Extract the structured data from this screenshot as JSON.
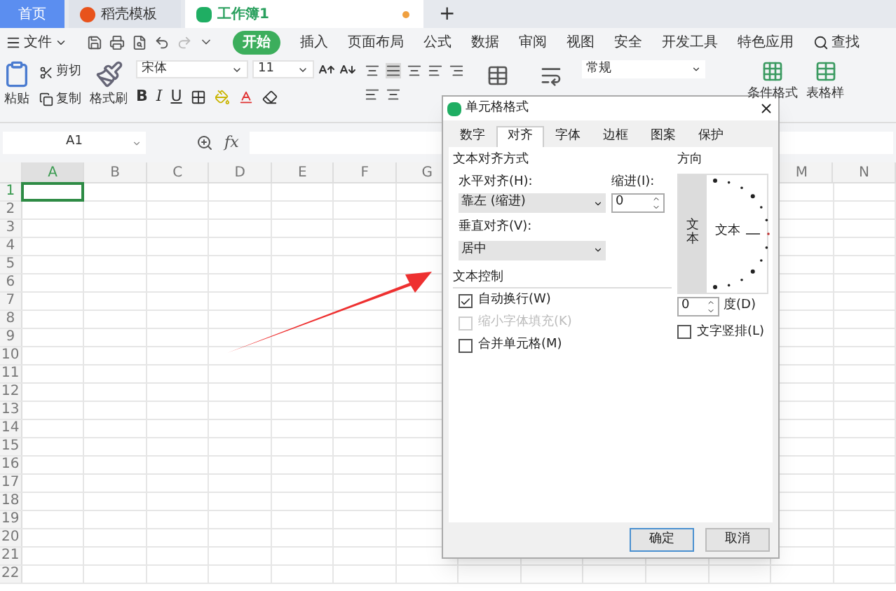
{
  "tabs": [
    {
      "label": "首页",
      "selected": false,
      "kind": "home"
    },
    {
      "label": "稻壳模板",
      "selected": false,
      "kind": "docer"
    },
    {
      "label": "工作簿1",
      "selected": true,
      "kind": "sheet"
    }
  ],
  "new_tab": "+",
  "menu": {
    "file": "文件",
    "tabs": [
      {
        "label": "开始",
        "selected": true
      },
      {
        "label": "插入",
        "selected": false
      },
      {
        "label": "页面布局",
        "selected": false
      },
      {
        "label": "公式",
        "selected": false
      },
      {
        "label": "数据",
        "selected": false
      },
      {
        "label": "审阅",
        "selected": false
      },
      {
        "label": "视图",
        "selected": false
      },
      {
        "label": "安全",
        "selected": false
      },
      {
        "label": "开发工具",
        "selected": false
      },
      {
        "label": "特色应用",
        "selected": false
      }
    ],
    "search": "查找"
  },
  "ribbon": {
    "paste": "粘贴",
    "cut": "剪切",
    "copy": "复制",
    "format_painter": "格式刷",
    "font": "宋体",
    "size": "11",
    "styles": [
      "B",
      "I",
      "U"
    ],
    "number_format": "常规",
    "conditional_format": "条件格式",
    "table_style": "表格样"
  },
  "formula_bar": {
    "cell": "A1",
    "fx": "fx"
  },
  "sheet": {
    "columns_left": [
      {
        "label": "A",
        "selected": true
      },
      {
        "label": "B",
        "selected": false
      },
      {
        "label": "C",
        "selected": false
      },
      {
        "label": "D",
        "selected": false
      },
      {
        "label": "E",
        "selected": false
      },
      {
        "label": "F",
        "selected": false
      },
      {
        "label": "G",
        "selected": false
      }
    ],
    "columns_right": [
      {
        "label": "M",
        "selected": false
      },
      {
        "label": "N",
        "selected": false
      }
    ],
    "rows": [
      {
        "label": "1",
        "selected": true
      },
      {
        "label": "2",
        "selected": false
      },
      {
        "label": "3",
        "selected": false
      },
      {
        "label": "4",
        "selected": false
      },
      {
        "label": "5",
        "selected": false
      },
      {
        "label": "6",
        "selected": false
      },
      {
        "label": "7",
        "selected": false
      },
      {
        "label": "8",
        "selected": false
      },
      {
        "label": "9",
        "selected": false
      },
      {
        "label": "10",
        "selected": false
      },
      {
        "label": "11",
        "selected": false
      },
      {
        "label": "12",
        "selected": false
      },
      {
        "label": "13",
        "selected": false
      },
      {
        "label": "14",
        "selected": false
      },
      {
        "label": "15",
        "selected": false
      },
      {
        "label": "16",
        "selected": false
      },
      {
        "label": "17",
        "selected": false
      },
      {
        "label": "18",
        "selected": false
      },
      {
        "label": "19",
        "selected": false
      },
      {
        "label": "20",
        "selected": false
      },
      {
        "label": "21",
        "selected": false
      },
      {
        "label": "22",
        "selected": false
      }
    ]
  },
  "dialog": {
    "title": "单元格格式",
    "tabs": [
      {
        "label": "数字",
        "selected": false
      },
      {
        "label": "对齐",
        "selected": true
      },
      {
        "label": "字体",
        "selected": false
      },
      {
        "label": "边框",
        "selected": false
      },
      {
        "label": "图案",
        "selected": false
      },
      {
        "label": "保护",
        "selected": false
      }
    ],
    "alignment": {
      "heading": "文本对齐方式",
      "horizontal_label": "水平对齐(H):",
      "horizontal_value": "靠左 (缩进)",
      "indent_label": "缩进(I):",
      "indent_value": "0",
      "vertical_label": "垂直对齐(V):",
      "vertical_value": "居中"
    },
    "text_control": {
      "heading": "文本控制",
      "options": [
        {
          "label": "自动换行(W)",
          "checked": true,
          "disabled": false
        },
        {
          "label": "缩小字体填充(K)",
          "checked": false,
          "disabled": true
        },
        {
          "label": "合并单元格(M)",
          "checked": false,
          "disabled": false
        }
      ]
    },
    "orientation": {
      "heading": "方向",
      "vertical_text": "文本",
      "dial_text": "文本",
      "degrees_value": "0",
      "degrees_label": "度(D)",
      "stacked": {
        "label": "文字竖排(L)",
        "checked": false
      }
    },
    "buttons": [
      "确定",
      "取消"
    ]
  }
}
